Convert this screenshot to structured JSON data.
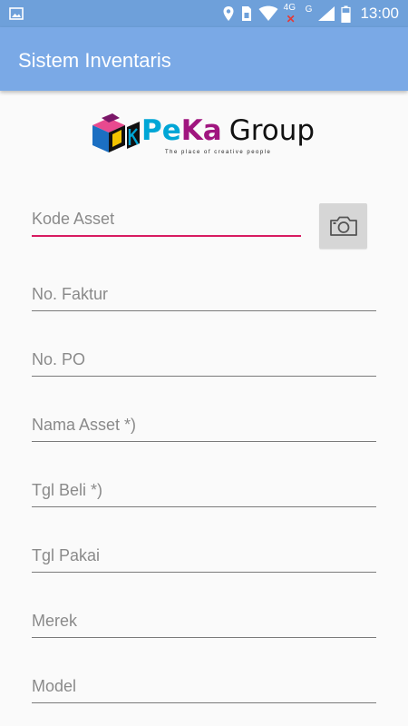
{
  "status_bar": {
    "time": "13:00",
    "network_label": "4G",
    "g_label": "G",
    "icons": [
      "image-icon",
      "location-icon",
      "sim-card-icon",
      "wifi-icon",
      "signal-4g-icon",
      "signal-icon",
      "battery-icon"
    ]
  },
  "app_bar": {
    "title": "Sistem Inventaris"
  },
  "logo": {
    "pe": "Pe",
    "ka": "Ka",
    "group": "Group",
    "tagline": "The place of creative people"
  },
  "form": {
    "fields": [
      {
        "placeholder": "Kode Asset"
      },
      {
        "placeholder": "No. Faktur"
      },
      {
        "placeholder": "No. PO"
      },
      {
        "placeholder": "Nama Asset *)"
      },
      {
        "placeholder": "Tgl Beli *)"
      },
      {
        "placeholder": "Tgl Pakai"
      },
      {
        "placeholder": "Merek"
      },
      {
        "placeholder": "Model"
      }
    ],
    "scan_button_icon": "camera-icon"
  },
  "colors": {
    "status_bar": "#6ea0da",
    "app_bar": "#7aa9e6",
    "accent": "#d81b60"
  }
}
